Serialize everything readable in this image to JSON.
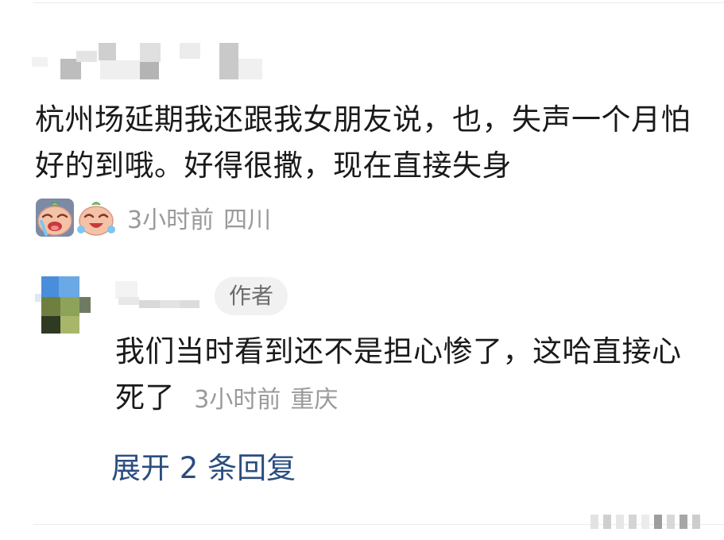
{
  "comment": {
    "text": "杭州场延期我还跟我女朋友说，也，失声一个月怕好的到哦。好得很撒，现在直接失身",
    "emoji_1": "grimace-crying-emoji",
    "emoji_2": "laughing-crying-emoji",
    "time": "3小时前",
    "location": "四川"
  },
  "reply": {
    "author_badge": "作者",
    "text": "我们当时看到还不是担心惨了，这哈直接心死了",
    "time": "3小时前",
    "location": "重庆"
  },
  "expand": {
    "label": "展开 2 条回复"
  },
  "colors": {
    "body_text": "#1a1a1a",
    "meta_text": "#9a9a9a",
    "link": "#2a4d7f",
    "badge_bg": "#f1f1f1",
    "badge_text": "#6b6b6b",
    "divider": "#ececec"
  }
}
